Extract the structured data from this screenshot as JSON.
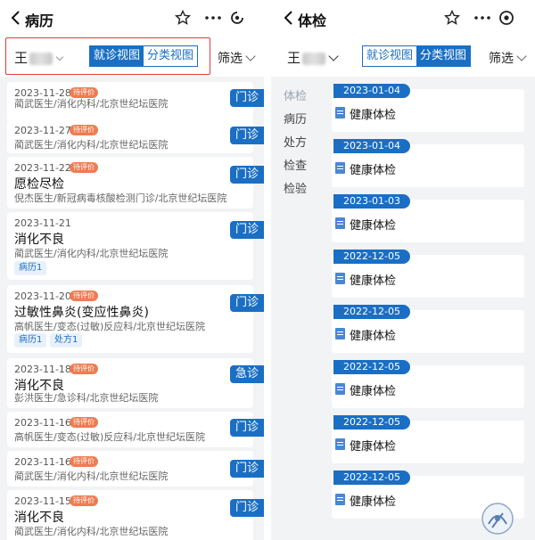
{
  "left": {
    "title": "病历",
    "user_name": "王",
    "view_tabs": [
      "就诊视图",
      "分类视图"
    ],
    "filter_label": "筛选",
    "records": [
      {
        "date": "2023-11-28",
        "badge": "待评价",
        "title": "",
        "dept": "蔺武医生/消化内科/北京世纪坛医院",
        "type": "门诊",
        "tags": []
      },
      {
        "date": "2023-11-27",
        "badge": "待评价",
        "title": "",
        "dept": "蔺武医生/消化内科/北京世纪坛医院",
        "type": "门诊",
        "tags": []
      },
      {
        "date": "2023-11-22",
        "badge": "待评价",
        "title": "愿检尽检",
        "dept": "倪杰医生/新冠病毒核酸检测门诊/北京世纪坛医院",
        "type": "门诊",
        "tags": []
      },
      {
        "date": "2023-11-21",
        "badge": "",
        "title": "消化不良",
        "dept": "蔺武医生/消化内科/北京世纪坛医院",
        "type": "门诊",
        "tags": [
          "病历1"
        ]
      },
      {
        "date": "2023-11-20",
        "badge": "待评价",
        "title": "过敏性鼻炎(变应性鼻炎)",
        "dept": "高帆医生/变态(过敏)反应科/北京世纪坛医院",
        "type": "门诊",
        "tags": [
          "病历1",
          "处方1"
        ]
      },
      {
        "date": "2023-11-18",
        "badge": "待评价",
        "title": "消化不良",
        "dept": "彭洪医生/急诊科/北京世纪坛医院",
        "type": "急诊",
        "tags": []
      },
      {
        "date": "2023-11-16",
        "badge": "待评价",
        "title": "",
        "dept": "高帆医生/变态(过敏)反应科/北京世纪坛医院",
        "type": "门诊",
        "tags": []
      },
      {
        "date": "2023-11-16",
        "badge": "待评价",
        "title": "",
        "dept": "蔺武医生/消化内科/北京世纪坛医院",
        "type": "门诊",
        "tags": []
      },
      {
        "date": "2023-11-15",
        "badge": "待评价",
        "title": "消化不良",
        "dept": "蔺武医生/消化内科/北京世纪坛医院",
        "type": "门诊",
        "tags": []
      }
    ]
  },
  "right": {
    "title": "体检",
    "user_name": "王",
    "view_tabs": [
      "就诊视图",
      "分类视图"
    ],
    "filter_label": "筛选",
    "categories": [
      "体检",
      "病历",
      "处方",
      "检查",
      "检验"
    ],
    "exams": [
      {
        "date": "2023-01-04",
        "name": "健康体检"
      },
      {
        "date": "2023-01-04",
        "name": "健康体检"
      },
      {
        "date": "2023-01-03",
        "name": "健康体检"
      },
      {
        "date": "2022-12-05",
        "name": "健康体检"
      },
      {
        "date": "2022-12-05",
        "name": "健康体检"
      },
      {
        "date": "2022-12-05",
        "name": "健康体检"
      },
      {
        "date": "2022-12-05",
        "name": "健康体检"
      },
      {
        "date": "2022-12-05",
        "name": "健康体检"
      }
    ]
  },
  "colors": {
    "accent": "#1a6fc4",
    "badge": "#f07b52",
    "highlight_box": "#e53935"
  }
}
